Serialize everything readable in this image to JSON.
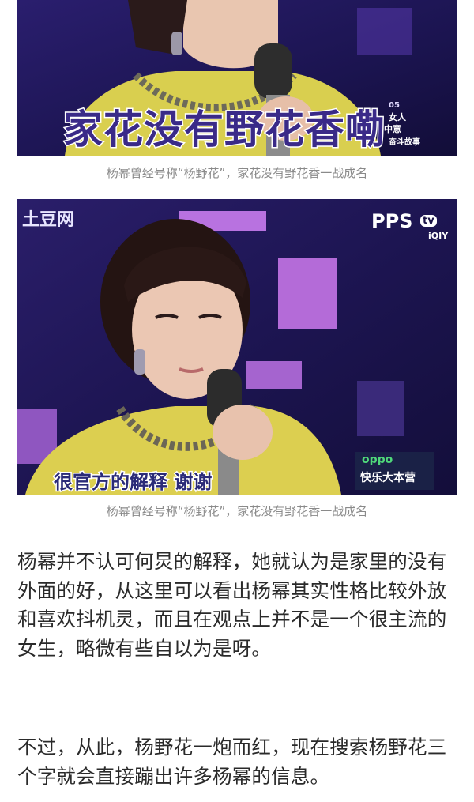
{
  "figure1": {
    "subtitle": "家花没有野花香嘞",
    "show_tag_line1": "05",
    "show_tag_line2": "女人",
    "show_tag_line3": "中意",
    "show_tag_line4": "奋斗故事"
  },
  "caption1": "杨幂曾经号称“杨野花”，家花没有野花香一战成名",
  "figure2": {
    "watermark_left": "土豆网",
    "watermark_right": "PPS",
    "watermark_right_tv": "tv",
    "watermark_right_sub": "iQIY",
    "subtitle": "很官方的解释 谢谢",
    "sponsor": "oppo",
    "sponsor_sub": "快乐大本营"
  },
  "caption2": "杨幂曾经号称“杨野花”，家花没有野花香一战成名",
  "paragraph1": "杨幂并不认可何炅的解释，她就认为是家里的没有外面的好，从这里可以看出杨幂其实性格比较外放和喜欢抖机灵，而且在观点上并不是一个很主流的女生，略微有些自以为是呀。",
  "paragraph2": "不过，从此，杨野花一炮而红，现在搜索杨野花三个字就会直接蹦出许多杨幂的信息。",
  "colors": {
    "caption": "#8a8a8a",
    "body_text": "#2a2a2a",
    "subtitle_fill": "#3a2a88",
    "stage_bg": "#1c1550"
  }
}
